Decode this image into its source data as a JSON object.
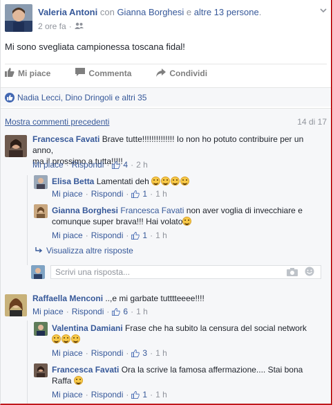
{
  "post": {
    "author": "Valeria Antoni",
    "with_word": "con",
    "tagged": "Gianna Borghesi",
    "and_word": "e",
    "others": "altre 13 persone",
    "period": ".",
    "time": "2 ore fa",
    "dot": "·",
    "text": "Mi sono svegliata campionessa toscana fidal!"
  },
  "actions": {
    "like": "Mi piace",
    "comment": "Commenta",
    "share": "Condividi"
  },
  "reactions": {
    "text": "Nadia Lecci, Dino Dringoli e altri 35"
  },
  "comments_meta": {
    "more": "Mostra commenti precedenti",
    "counter": "14 di 17"
  },
  "labels": {
    "like": "Mi piace",
    "reply": "Rispondi",
    "dot": "·",
    "view_more_replies": "Visualizza altre risposte",
    "reply_placeholder": "Scrivi una risposta..."
  },
  "comments": [
    {
      "author": "Francesca Favati",
      "text_line1": "Brave tutte!!!!!!!!!!!!!! Io non ho potuto contribuire per un anno,",
      "text_line2": "ma il prossimo a tutta!!!!!",
      "likes": "4",
      "time": "2 h"
    },
    {
      "author": "Elisa Betta",
      "text": "Lamentati deh",
      "likes": "1",
      "time": "1 h"
    },
    {
      "author": "Gianna Borghesi",
      "mention": "Francesca Favati",
      "text_line1": "non aver voglia di invecchiare e",
      "text_line2": "comunque super brava!!! Hai volato",
      "likes": "1",
      "time": "1 h"
    },
    {
      "author": "Raffaella Menconi",
      "text": "..,e mi garbate tutttteeee!!!!",
      "likes": "6",
      "time": "1 h"
    },
    {
      "author": "Valentina Damiani",
      "text": "Frase che ha subito la censura del social network",
      "likes": "3",
      "time": "1 h"
    },
    {
      "author": "Francesca Favati",
      "text_line1": "Ora la scrive la famosa affermazione.... Stai bona",
      "text_line2": "Raffa",
      "likes": "1",
      "time": "1 h"
    }
  ],
  "colors": {
    "link": "#365899",
    "muted": "#90949c",
    "frame": "#c0181c",
    "emoji": "#f7c948"
  }
}
